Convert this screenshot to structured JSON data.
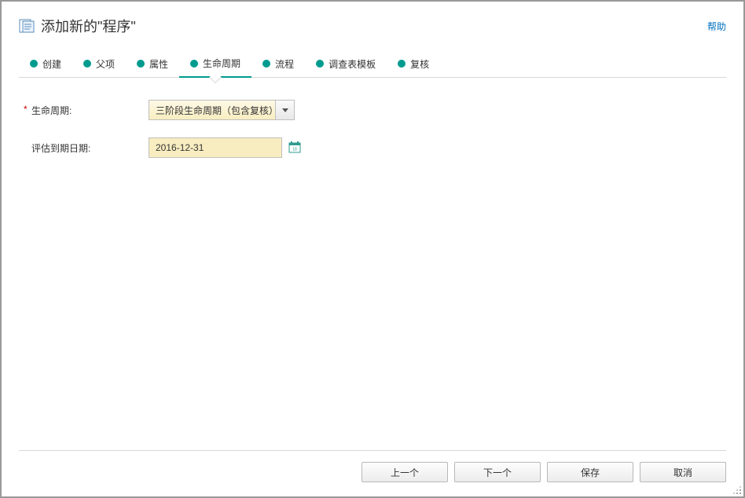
{
  "header": {
    "title": "添加新的\"程序\"",
    "help_label": "帮助"
  },
  "tabs": [
    {
      "label": "创建",
      "active": false
    },
    {
      "label": "父项",
      "active": false
    },
    {
      "label": "属性",
      "active": false
    },
    {
      "label": "生命周期",
      "active": true
    },
    {
      "label": "流程",
      "active": false
    },
    {
      "label": "调查表模板",
      "active": false
    },
    {
      "label": "复核",
      "active": false
    }
  ],
  "form": {
    "lifecycle_label": "生命周期:",
    "lifecycle_value": "三阶段生命周期（包含复核）",
    "due_date_label": "评估到期日期:",
    "due_date_value": "2016-12-31"
  },
  "footer": {
    "prev": "上一个",
    "next": "下一个",
    "save": "保存",
    "cancel": "取消"
  }
}
